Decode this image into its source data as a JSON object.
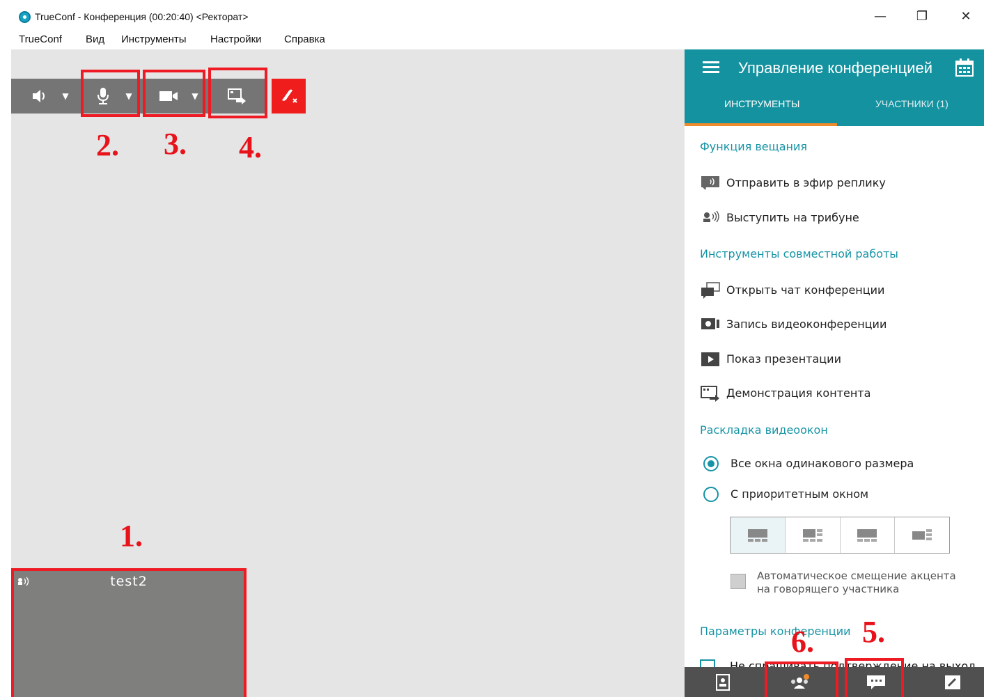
{
  "window": {
    "title": "TrueConf - Конференция (00:20:40) <Ректорат>",
    "minimize": "—",
    "restore": "❐",
    "close": "✕"
  },
  "menu": [
    "TrueConf",
    "Вид",
    "Инструменты",
    "Настройки",
    "Справка"
  ],
  "toolbar": {
    "icons": [
      "speaker-icon",
      "microphone-icon",
      "camera-icon",
      "share-screen-icon",
      "hangup-icon"
    ],
    "dropdown_arrow": "▼"
  },
  "annotations": {
    "n1": "1.",
    "n2": "2.",
    "n3": "3.",
    "n4": "4.",
    "n5": "5.",
    "n6": "6."
  },
  "colors": {
    "accent": "#14929f",
    "tab_underline": "#f08b2b",
    "annotation_red": "#ee1b24",
    "hangup_red": "#f01d1d"
  },
  "participant": {
    "name": "test2"
  },
  "panel": {
    "title": "Управление конференцией",
    "tabs": [
      "ИНСТРУМЕНТЫ",
      "УЧАСТНИКИ (1)"
    ],
    "active_tab": 0,
    "sections": {
      "broadcast": "Функция вещания",
      "collab": "Инструменты совместной работы",
      "layout": "Раскладка видеоокон",
      "params": "Параметры конференции"
    },
    "broadcast_items": [
      "Отправить в эфир реплику",
      "Выступить на трибуне"
    ],
    "collab_items": [
      "Открыть чат конференции",
      "Запись видеоконференции",
      "Показ презентации",
      "Демонстрация контента"
    ],
    "layout_options": [
      "Все окна одинакового размера",
      "С приоритетным окном"
    ],
    "layout_selected": 0,
    "auto_shift": [
      "Автоматическое смещение акцента",
      "на говорящего участника"
    ],
    "cut_text": "Не спрашивать подтверждение на выход"
  },
  "bottom_bar": {
    "icons": [
      "contacts-icon",
      "participants-icon",
      "chat-icon",
      "call-icon"
    ]
  }
}
